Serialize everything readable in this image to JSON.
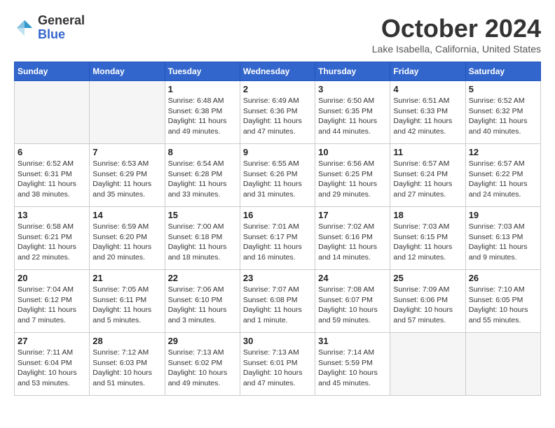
{
  "header": {
    "logo": {
      "general": "General",
      "blue": "Blue",
      "arrow_color": "#3399cc"
    },
    "title": "October 2024",
    "location": "Lake Isabella, California, United States"
  },
  "weekdays": [
    "Sunday",
    "Monday",
    "Tuesday",
    "Wednesday",
    "Thursday",
    "Friday",
    "Saturday"
  ],
  "weeks": [
    [
      {
        "day": "",
        "empty": true
      },
      {
        "day": "",
        "empty": true
      },
      {
        "day": "1",
        "sunrise": "6:48 AM",
        "sunset": "6:38 PM",
        "daylight": "11 hours and 49 minutes."
      },
      {
        "day": "2",
        "sunrise": "6:49 AM",
        "sunset": "6:36 PM",
        "daylight": "11 hours and 47 minutes."
      },
      {
        "day": "3",
        "sunrise": "6:50 AM",
        "sunset": "6:35 PM",
        "daylight": "11 hours and 44 minutes."
      },
      {
        "day": "4",
        "sunrise": "6:51 AM",
        "sunset": "6:33 PM",
        "daylight": "11 hours and 42 minutes."
      },
      {
        "day": "5",
        "sunrise": "6:52 AM",
        "sunset": "6:32 PM",
        "daylight": "11 hours and 40 minutes."
      }
    ],
    [
      {
        "day": "6",
        "sunrise": "6:52 AM",
        "sunset": "6:31 PM",
        "daylight": "11 hours and 38 minutes."
      },
      {
        "day": "7",
        "sunrise": "6:53 AM",
        "sunset": "6:29 PM",
        "daylight": "11 hours and 35 minutes."
      },
      {
        "day": "8",
        "sunrise": "6:54 AM",
        "sunset": "6:28 PM",
        "daylight": "11 hours and 33 minutes."
      },
      {
        "day": "9",
        "sunrise": "6:55 AM",
        "sunset": "6:26 PM",
        "daylight": "11 hours and 31 minutes."
      },
      {
        "day": "10",
        "sunrise": "6:56 AM",
        "sunset": "6:25 PM",
        "daylight": "11 hours and 29 minutes."
      },
      {
        "day": "11",
        "sunrise": "6:57 AM",
        "sunset": "6:24 PM",
        "daylight": "11 hours and 27 minutes."
      },
      {
        "day": "12",
        "sunrise": "6:57 AM",
        "sunset": "6:22 PM",
        "daylight": "11 hours and 24 minutes."
      }
    ],
    [
      {
        "day": "13",
        "sunrise": "6:58 AM",
        "sunset": "6:21 PM",
        "daylight": "11 hours and 22 minutes."
      },
      {
        "day": "14",
        "sunrise": "6:59 AM",
        "sunset": "6:20 PM",
        "daylight": "11 hours and 20 minutes."
      },
      {
        "day": "15",
        "sunrise": "7:00 AM",
        "sunset": "6:18 PM",
        "daylight": "11 hours and 18 minutes."
      },
      {
        "day": "16",
        "sunrise": "7:01 AM",
        "sunset": "6:17 PM",
        "daylight": "11 hours and 16 minutes."
      },
      {
        "day": "17",
        "sunrise": "7:02 AM",
        "sunset": "6:16 PM",
        "daylight": "11 hours and 14 minutes."
      },
      {
        "day": "18",
        "sunrise": "7:03 AM",
        "sunset": "6:15 PM",
        "daylight": "11 hours and 12 minutes."
      },
      {
        "day": "19",
        "sunrise": "7:03 AM",
        "sunset": "6:13 PM",
        "daylight": "11 hours and 9 minutes."
      }
    ],
    [
      {
        "day": "20",
        "sunrise": "7:04 AM",
        "sunset": "6:12 PM",
        "daylight": "11 hours and 7 minutes."
      },
      {
        "day": "21",
        "sunrise": "7:05 AM",
        "sunset": "6:11 PM",
        "daylight": "11 hours and 5 minutes."
      },
      {
        "day": "22",
        "sunrise": "7:06 AM",
        "sunset": "6:10 PM",
        "daylight": "11 hours and 3 minutes."
      },
      {
        "day": "23",
        "sunrise": "7:07 AM",
        "sunset": "6:08 PM",
        "daylight": "11 hours and 1 minute."
      },
      {
        "day": "24",
        "sunrise": "7:08 AM",
        "sunset": "6:07 PM",
        "daylight": "10 hours and 59 minutes."
      },
      {
        "day": "25",
        "sunrise": "7:09 AM",
        "sunset": "6:06 PM",
        "daylight": "10 hours and 57 minutes."
      },
      {
        "day": "26",
        "sunrise": "7:10 AM",
        "sunset": "6:05 PM",
        "daylight": "10 hours and 55 minutes."
      }
    ],
    [
      {
        "day": "27",
        "sunrise": "7:11 AM",
        "sunset": "6:04 PM",
        "daylight": "10 hours and 53 minutes."
      },
      {
        "day": "28",
        "sunrise": "7:12 AM",
        "sunset": "6:03 PM",
        "daylight": "10 hours and 51 minutes."
      },
      {
        "day": "29",
        "sunrise": "7:13 AM",
        "sunset": "6:02 PM",
        "daylight": "10 hours and 49 minutes."
      },
      {
        "day": "30",
        "sunrise": "7:13 AM",
        "sunset": "6:01 PM",
        "daylight": "10 hours and 47 minutes."
      },
      {
        "day": "31",
        "sunrise": "7:14 AM",
        "sunset": "5:59 PM",
        "daylight": "10 hours and 45 minutes."
      },
      {
        "day": "",
        "empty": true
      },
      {
        "day": "",
        "empty": true
      }
    ]
  ]
}
